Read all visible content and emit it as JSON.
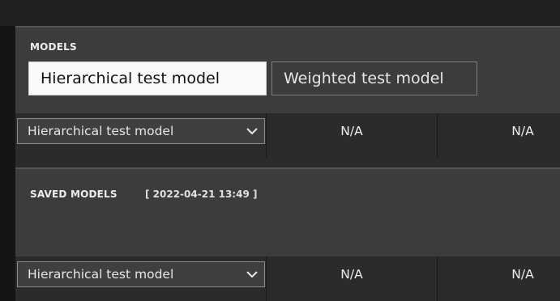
{
  "models_panel": {
    "title": "MODELS",
    "tabs": [
      {
        "label": "Hierarchical test model",
        "active": true
      },
      {
        "label": "Weighted test model",
        "active": false
      }
    ]
  },
  "model_row": {
    "selected": "Hierarchical test model",
    "values": [
      "N/A",
      "N/A"
    ]
  },
  "saved_panel": {
    "title": "SAVED MODELS",
    "timestamp": "[ 2022-04-21 13:49 ]"
  },
  "saved_row": {
    "selected": "Hierarchical test model",
    "values": [
      "N/A",
      "N/A"
    ]
  },
  "colors": {
    "background": "#2b2b2b",
    "panel": "#3c3c3c",
    "active_tab": "#fafafa",
    "text": "#eeeeee"
  }
}
